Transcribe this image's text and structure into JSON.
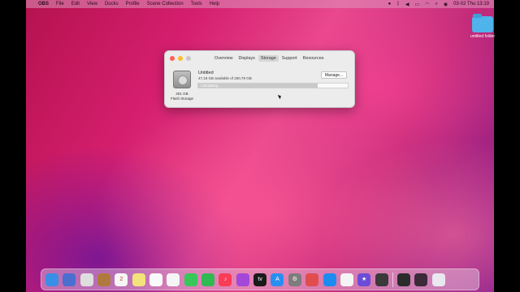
{
  "menubar": {
    "apple": "",
    "items": [
      "OBS",
      "File",
      "Edit",
      "View",
      "Docks",
      "Profile",
      "Scene Collection",
      "Tools",
      "Help"
    ],
    "clock": "03-02 Thu 13:19"
  },
  "desktop": {
    "folder_label": "untitled folder"
  },
  "window": {
    "tabs": [
      "Overview",
      "Displays",
      "Storage",
      "Support",
      "Resources"
    ],
    "active_tab": "Storage",
    "volume_name": "Untitled",
    "volume_available": "47,18 GB available of 250,79 GB",
    "manage_label": "Manage...",
    "progress_text": "Calculating...",
    "progress_fraction": 0.8,
    "drive_size": "251 GB",
    "drive_kind": "Flash Storage"
  },
  "colors": {
    "close": "#ff5f57",
    "minimize": "#febc2e",
    "accent": "#e8488d"
  },
  "dock": {
    "apps": [
      {
        "name": "finder-icon",
        "color": "#3a8ee6",
        "glyph": ""
      },
      {
        "name": "launchpad-icon",
        "color": "#4a6fd0",
        "glyph": ""
      },
      {
        "name": "app-grid-icon",
        "color": "#dedede",
        "glyph": ""
      },
      {
        "name": "contacts-icon",
        "color": "#b07a3e",
        "glyph": ""
      },
      {
        "name": "calendar-icon",
        "color": "#f6f6f6",
        "glyph": "2"
      },
      {
        "name": "notes-icon",
        "color": "#f2e37a",
        "glyph": ""
      },
      {
        "name": "reminders-icon",
        "color": "#fafafa",
        "glyph": ""
      },
      {
        "name": "photos-icon",
        "color": "#f5f5f5",
        "glyph": ""
      },
      {
        "name": "messages-icon",
        "color": "#38c759",
        "glyph": ""
      },
      {
        "name": "facetime-icon",
        "color": "#2fba52",
        "glyph": ""
      },
      {
        "name": "music-icon",
        "color": "#fa3c55",
        "glyph": "♪"
      },
      {
        "name": "podcasts-icon",
        "color": "#a348d8",
        "glyph": ""
      },
      {
        "name": "apple-tv-icon",
        "color": "#1a1a1a",
        "glyph": "tv"
      },
      {
        "name": "app-store-icon",
        "color": "#2a8ef0",
        "glyph": "A"
      },
      {
        "name": "system-preferences-icon",
        "color": "#7d7d7d",
        "glyph": "⚙"
      },
      {
        "name": "maps-icon",
        "color": "#e14d4d",
        "glyph": ""
      },
      {
        "name": "safari-icon",
        "color": "#1d8cf0",
        "glyph": ""
      },
      {
        "name": "chrome-icon",
        "color": "#f4f4f4",
        "glyph": ""
      },
      {
        "name": "imovie-icon",
        "color": "#6b4cd8",
        "glyph": "★"
      },
      {
        "name": "utility-icon",
        "color": "#3a3a3a",
        "glyph": ""
      },
      {
        "name": "obs-icon",
        "color": "#2b2b2b",
        "glyph": ""
      },
      {
        "name": "screen-recorder-icon",
        "color": "#3a2a3a",
        "glyph": ""
      },
      {
        "name": "trash-icon",
        "color": "#e8e8ee",
        "glyph": ""
      }
    ]
  }
}
